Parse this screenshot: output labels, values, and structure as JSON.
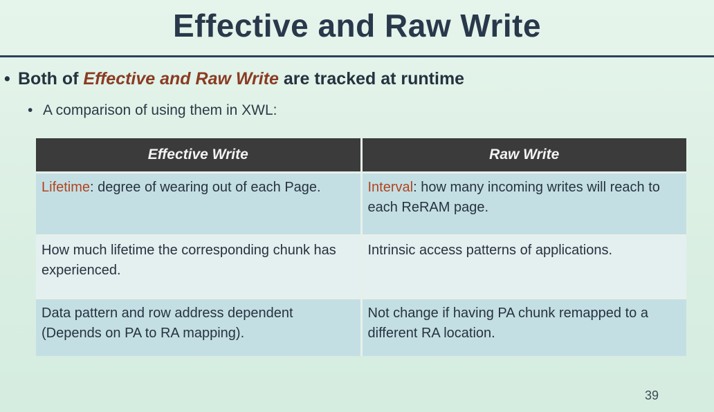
{
  "slide": {
    "title": "Effective and Raw Write",
    "bullet1": {
      "prefix": "Both of ",
      "emphasis": "Effective and Raw Write",
      "suffix": " are tracked at runtime"
    },
    "bullet2": "A comparison of using them in XWL:",
    "page_number": "39"
  },
  "table": {
    "headers": [
      "Effective Write",
      "Raw Write"
    ],
    "rows": [
      {
        "left_key": "Lifetime",
        "left_rest": ": degree of wearing out of each Page.",
        "right_key": "Interval",
        "right_rest": ": how many incoming writes will reach to each ReRAM page."
      },
      {
        "left": "How much lifetime the corresponding chunk has experienced.",
        "right": "Intrinsic access patterns of applications."
      },
      {
        "left": "Data pattern and row address dependent (Depends on PA to RA mapping).",
        "right": "Not change if having PA chunk remapped to a different RA location."
      }
    ]
  },
  "colors": {
    "accent": "#b0441f",
    "header_bg": "#3b3b3b"
  }
}
